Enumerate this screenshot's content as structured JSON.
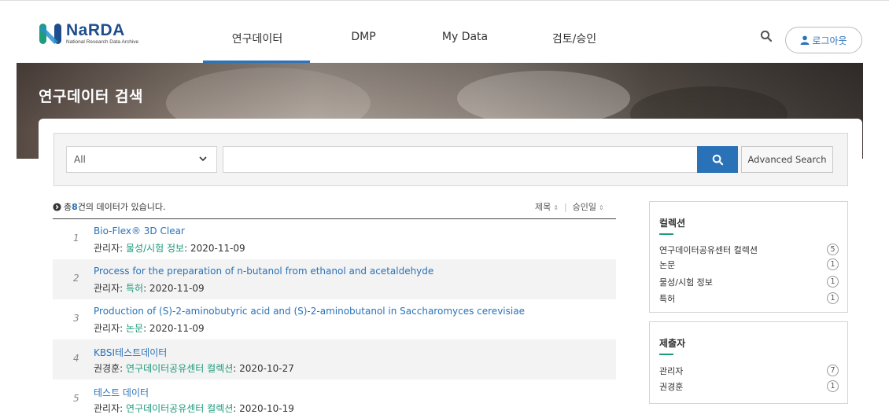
{
  "header": {
    "logo_name": "NaRDA",
    "logo_sub": "National Research Data Archive",
    "nav": [
      "연구데이터",
      "DMP",
      "My Data",
      "검토/승인"
    ],
    "logout_label": "로그아웃"
  },
  "banner": {
    "title": "연구데이터 검색"
  },
  "search": {
    "select_value": "All",
    "input_value": "",
    "advanced_label": "Advanced Search"
  },
  "results": {
    "count_prefix": "총 ",
    "count": "8",
    "count_suffix": "건의 데이터가 있습니다.",
    "sort_title": "제목",
    "sort_date": "승인일",
    "sort_arrows": "⇕",
    "items": [
      {
        "num": "1",
        "title": "Bio-Flex® 3D Clear",
        "owner": "관리자: ",
        "category": "물성/시험 정보",
        "date": ": 2020-11-09"
      },
      {
        "num": "2",
        "title": "Process for the preparation of n-butanol from ethanol and acetaldehyde",
        "owner": "관리자: ",
        "category": "특허",
        "date": ": 2020-11-09"
      },
      {
        "num": "3",
        "title": "Production of (S)-2-aminobutyric acid and (S)-2-aminobutanol in Saccharomyces cerevisiae",
        "owner": "관리자: ",
        "category": "논문",
        "date": ": 2020-11-09"
      },
      {
        "num": "4",
        "title": "KBSI테스트데이터",
        "owner": "권경훈: ",
        "category": "연구데이터공유센터 컬렉션",
        "date": ": 2020-10-27"
      },
      {
        "num": "5",
        "title": "테스트 데이터",
        "owner": "관리자: ",
        "category": "연구데이터공유센터 컬렉션",
        "date": ": 2020-10-19"
      }
    ]
  },
  "facets": {
    "collection": {
      "title": "컬렉션",
      "items": [
        {
          "label": "연구데이터공유센터 컬렉션",
          "count": "5"
        },
        {
          "label": "논문",
          "count": "1"
        },
        {
          "label": "물성/시험 정보",
          "count": "1"
        },
        {
          "label": "특허",
          "count": "1"
        }
      ]
    },
    "submitter": {
      "title": "제출자",
      "items": [
        {
          "label": "관리자",
          "count": "7"
        },
        {
          "label": "권경훈",
          "count": "1"
        }
      ]
    }
  },
  "colors": {
    "primary": "#2a72b8",
    "accent": "#1c9a7a",
    "logo_green": "#1f9c7a"
  },
  "icons": [
    "narda-logo-icon",
    "search-icon",
    "user-icon",
    "chevron-down-icon",
    "circle-arrow-icon"
  ]
}
